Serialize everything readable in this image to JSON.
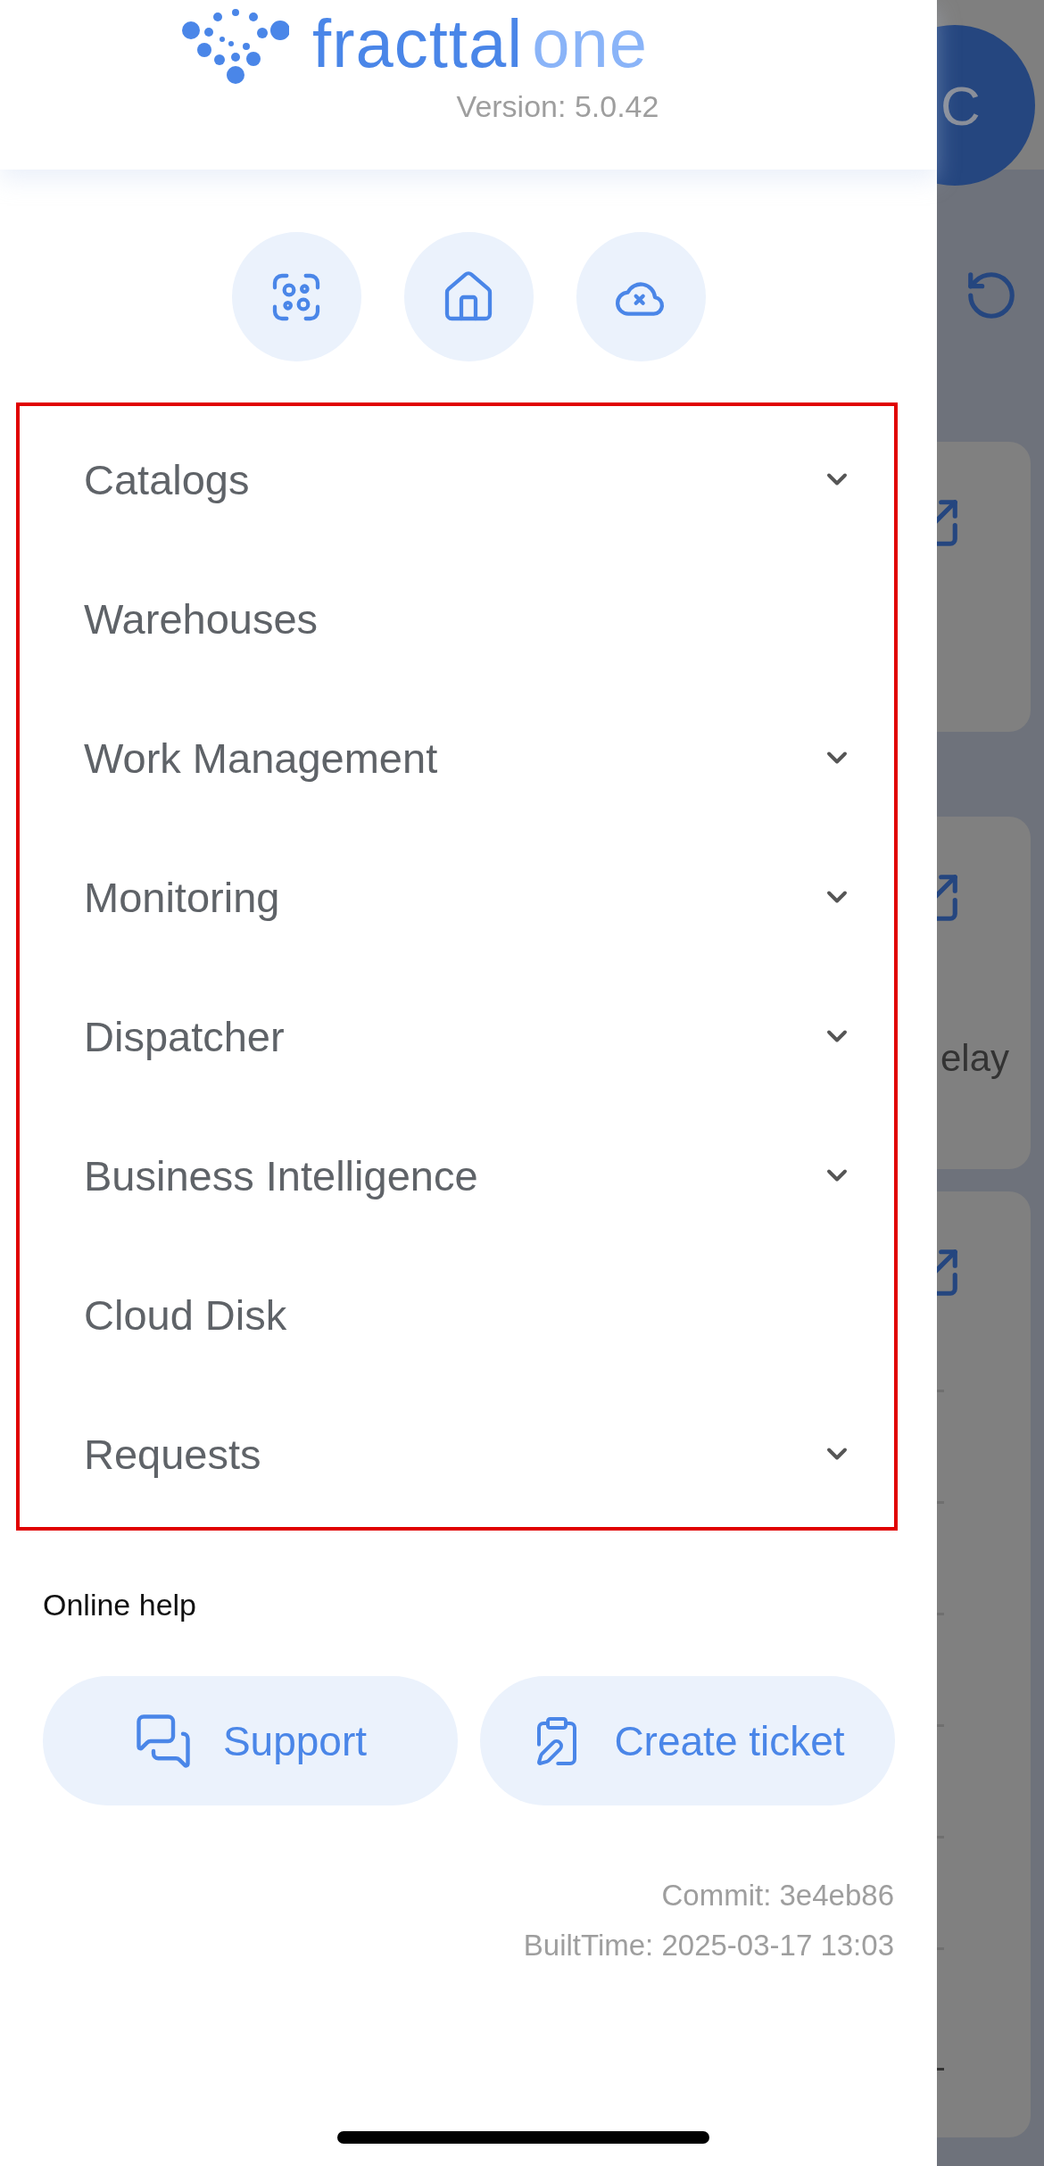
{
  "header": {
    "logo": {
      "primary": "fracttal",
      "secondary": "one"
    },
    "version": "Version: 5.0.42"
  },
  "quick_actions": [
    {
      "kind": "scan"
    },
    {
      "kind": "home"
    },
    {
      "kind": "cloud-off"
    }
  ],
  "menu": {
    "highlighted": true,
    "items": [
      {
        "label": "Catalogs",
        "expandable": true
      },
      {
        "label": "Warehouses",
        "expandable": false
      },
      {
        "label": "Work Management",
        "expandable": true
      },
      {
        "label": "Monitoring",
        "expandable": true
      },
      {
        "label": "Dispatcher",
        "expandable": true
      },
      {
        "label": "Business Intelligence",
        "expandable": true
      },
      {
        "label": "Cloud Disk",
        "expandable": false
      },
      {
        "label": "Requests",
        "expandable": true
      }
    ]
  },
  "help": {
    "title": "Online help",
    "buttons": [
      {
        "label": "Support",
        "kind": "support"
      },
      {
        "label": "Create ticket",
        "kind": "ticket"
      }
    ]
  },
  "build": {
    "commit": "Commit: 3e4eb86",
    "built_time": "BuiltTime: 2025-03-17 13:03"
  },
  "background": {
    "avatar": "C",
    "card_text": "elay"
  }
}
